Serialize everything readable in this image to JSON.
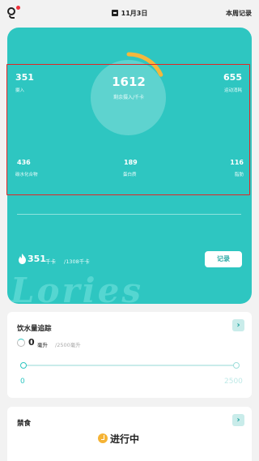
{
  "header": {
    "date": "11月3日",
    "weekly_record": "本周记录",
    "icons": {
      "logo": "app-logo",
      "calendar": "calendar-icon"
    }
  },
  "summary": {
    "intake_value": "351",
    "intake_label": "摄入",
    "remaining_value": "1612",
    "remaining_label": "剩余摄入/千卡",
    "burned_value": "655",
    "burned_label": "运动消耗",
    "ring_progress": 0.18,
    "colors": {
      "card": "#2ec6c1",
      "ring": "#f4b73c"
    }
  },
  "macros": [
    {
      "value": "436",
      "label": "碳水化合物"
    },
    {
      "value": "189",
      "label": "蛋白质"
    },
    {
      "value": "116",
      "label": "脂肪"
    }
  ],
  "calories": {
    "value": "351",
    "unit": "千卡",
    "goal": "/1308千卡",
    "record_button": "记录",
    "icon": "flame-icon"
  },
  "watermark": "Lories",
  "water": {
    "title": "饮水量追踪",
    "value": "0",
    "unit": "毫升",
    "goal": "/2500毫升",
    "scale_min": "0",
    "scale_max": "2500",
    "progress": 0
  },
  "fasting": {
    "title": "禁食",
    "status": "进行中"
  }
}
